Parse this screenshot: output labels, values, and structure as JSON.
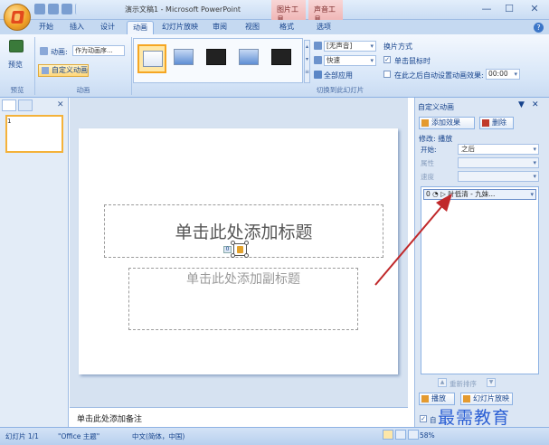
{
  "window": {
    "title": "演示文稿1 - Microsoft PowerPoint",
    "contextual_tabs": [
      "图片工具",
      "声音工具"
    ],
    "controls": {
      "minimize": "—",
      "maximize": "☐",
      "close": "✕"
    }
  },
  "ribbon": {
    "tabs": [
      "开始",
      "插入",
      "设计",
      "动画",
      "幻灯片放映",
      "审阅",
      "视图",
      "格式",
      "选项"
    ],
    "active_tab": "动画",
    "preview": {
      "label": "预览",
      "group_label": "预览"
    },
    "animations": {
      "label": "动画:",
      "select_value": "作为动画序...",
      "custom_button": "自定义动画",
      "group_label": "动画"
    },
    "transition": {
      "sound_value": "[无声音]",
      "speed_value": "快速",
      "apply_all": "全部应用",
      "advance_title": "换片方式",
      "on_click": "单击鼠标时",
      "on_click_checked": true,
      "after_label": "在此之后自动设置动画效果:",
      "after_value": "00:00",
      "group_label": "切换到此幻灯片"
    }
  },
  "slide_pane": {
    "close": "✕",
    "thumb_number": "1"
  },
  "slide": {
    "title_placeholder": "单击此处添加标题",
    "subtitle_placeholder": "单击此处添加副标题",
    "anim_tag": "0"
  },
  "notes": {
    "placeholder": "单击此处添加备注"
  },
  "task_pane": {
    "title": "自定义动画",
    "arrow": "▼",
    "close": "✕",
    "add_effect": "添加效果",
    "remove": "删除",
    "section": "修改: 播放",
    "start_label": "开始:",
    "start_value": "之后",
    "property_label": "属性",
    "speed_label": "速度",
    "list_item": "0 ◔ ▷ 叶低清 - 九妹...",
    "reorder": "重新排序",
    "play": "播放",
    "slideshow": "幻灯片放映",
    "autopreview": "自"
  },
  "status_bar": {
    "slide_info": "幻灯片 1/1",
    "theme": "\"Office 主题\"",
    "language": "中文(简体，中国)",
    "zoom": "58%"
  },
  "watermark": {
    "text": "最需教育"
  },
  "colors": {
    "accent": "#15428b",
    "annotation_arrow": "#c0282a",
    "watermark": "#2b5fd4"
  }
}
